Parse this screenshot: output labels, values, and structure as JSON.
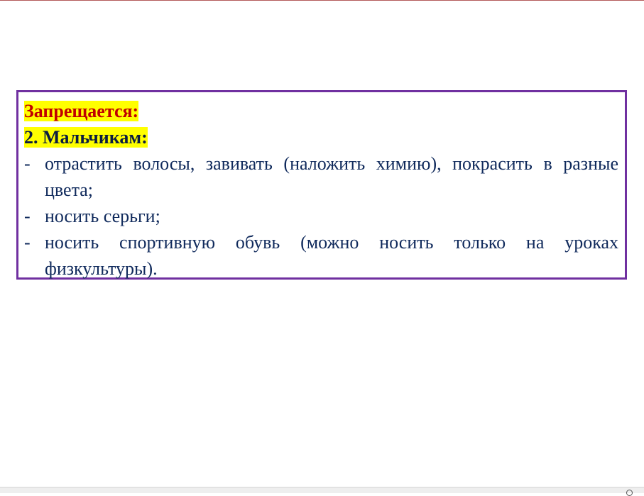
{
  "slide": {
    "prohibited_label": "Запрещается:",
    "section_label": "2. Мальчикам:",
    "rules": [
      {
        "marker": "-",
        "text": "отрастить волосы, завивать (наложить химию), покрасить в разные цвета;"
      },
      {
        "marker": "-",
        "text": "носить серьги;"
      },
      {
        "marker": "-",
        "text": "носить спортивную обувь (можно носить только на уроках физкультуры)."
      }
    ]
  },
  "colors": {
    "border": "#7030a0",
    "highlight": "#ffff00",
    "warning_text": "#c00000",
    "body_text": "#102a5c"
  },
  "icons": {
    "status_bar_right": "zoom-icon"
  }
}
